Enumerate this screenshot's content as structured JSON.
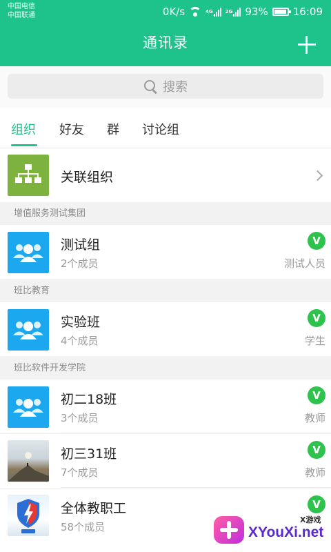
{
  "status_bar": {
    "carrier1": "中国电信",
    "carrier2": "中国联通",
    "speed": "0K/s",
    "net1": "4G",
    "net2": "2G",
    "battery": "93%",
    "time": "16:09"
  },
  "header": {
    "title": "通讯录"
  },
  "search": {
    "placeholder": "搜索"
  },
  "tabs": [
    {
      "label": "组织",
      "active": true
    },
    {
      "label": "好友",
      "active": false
    },
    {
      "label": "群",
      "active": false
    },
    {
      "label": "讨论组",
      "active": false
    }
  ],
  "linked_org": {
    "label": "关联组织"
  },
  "sections": [
    {
      "header": "增值服务测试集团",
      "items": [
        {
          "name": "测试组",
          "members": "2个成员",
          "role": "测试人员",
          "badge": "V"
        }
      ]
    },
    {
      "header": "班比教育",
      "items": [
        {
          "name": "实验班",
          "members": "4个成员",
          "role": "学生",
          "badge": "V"
        }
      ]
    },
    {
      "header": "班比软件开发学院",
      "items": [
        {
          "name": "初二18班",
          "members": "3个成员",
          "role": "教师",
          "badge": "V"
        },
        {
          "name": "初三31班",
          "members": "7个成员",
          "role": "教师",
          "badge": "V"
        },
        {
          "name": "全体教职工",
          "members": "58个成员",
          "role": "",
          "badge": "V"
        }
      ]
    }
  ],
  "watermark": {
    "brand": "XYouXi.net",
    "label": "X游戏"
  },
  "colors": {
    "primary": "#1ec28b",
    "badge": "#2fc24c",
    "avatar_blue": "#1ba8ef",
    "org_green": "#7db23e"
  }
}
